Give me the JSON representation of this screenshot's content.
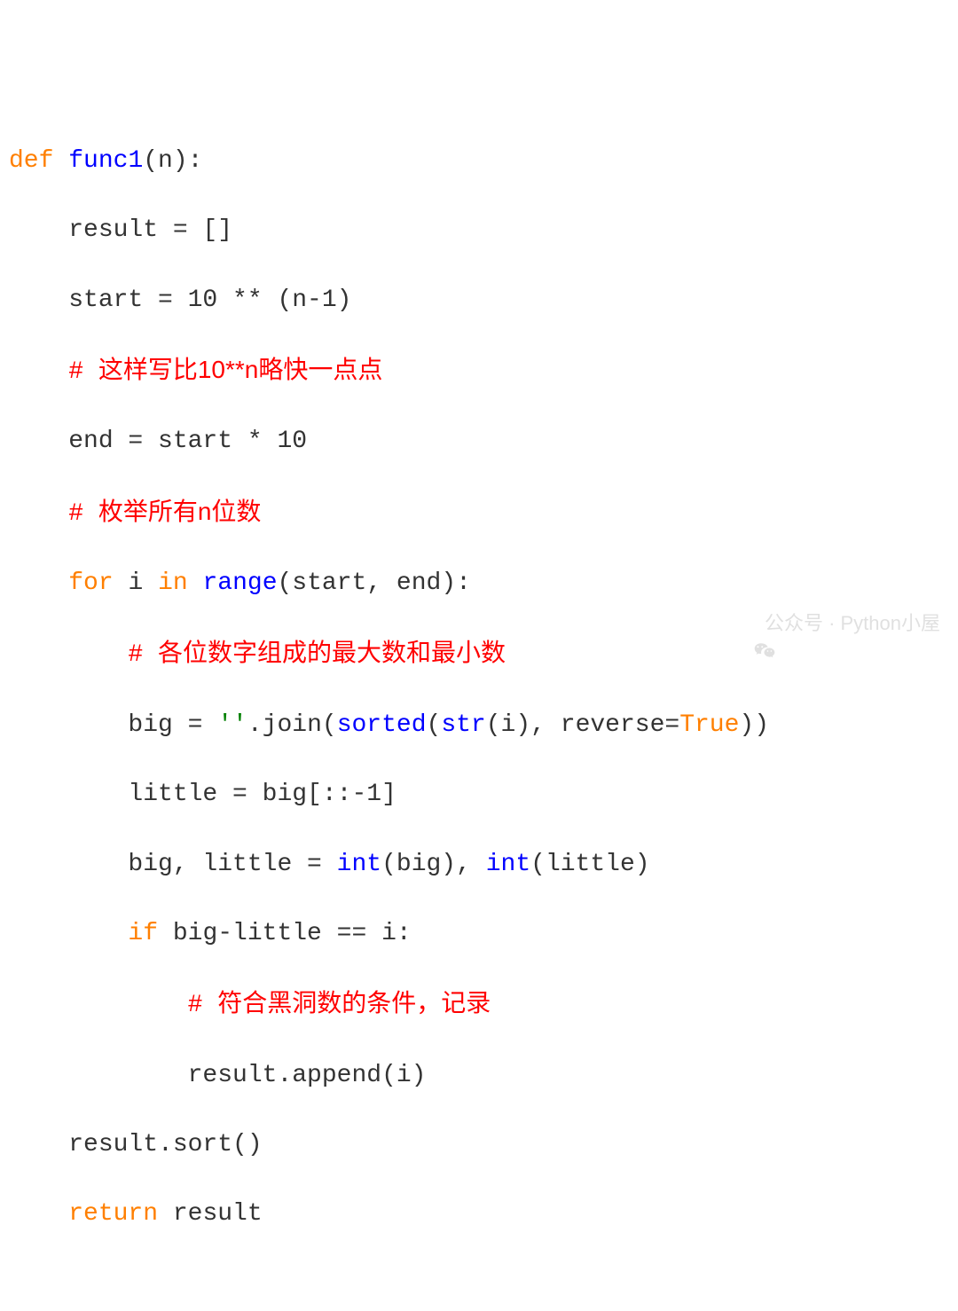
{
  "lines": {
    "l1_def": "def",
    "l1_func": "func1",
    "l1_rest": "(n):",
    "l2": "    result = []",
    "l3": "    start = 10 ** (n-1)",
    "l4_hash": "    # ",
    "l4_text": "这样写比10**n略快一点点",
    "l5": "    end = start * 10",
    "l6_hash": "    # ",
    "l6_text": "枚举所有n位数",
    "l7_pre": "    ",
    "l7_for": "for",
    "l7_mid1": " i ",
    "l7_in": "in",
    "l7_mid2": " ",
    "l7_range": "range",
    "l7_rest": "(start, end):",
    "l8_hash": "        # ",
    "l8_text": "各位数字组成的最大数和最小数",
    "l9_pre": "        big = ",
    "l9_str": "''",
    "l9_mid1": ".join(",
    "l9_sorted": "sorted",
    "l9_mid2": "(",
    "l9_strf": "str",
    "l9_mid3": "(i), reverse=",
    "l9_true": "True",
    "l9_rest": "))",
    "l10": "        little = big[::-1]",
    "l11_pre": "        big, little = ",
    "l11_int1": "int",
    "l11_mid": "(big), ",
    "l11_int2": "int",
    "l11_rest": "(little)",
    "l12_pre": "        ",
    "l12_if": "if",
    "l12_rest": " big-little == i:",
    "l13_hash": "            # ",
    "l13_text": "符合黑洞数的条件，记录",
    "l14": "            result.append(i)",
    "l15": "    result.sort()",
    "l16_pre": "    ",
    "l16_return": "return",
    "l16_rest": " result"
  },
  "watermark": {
    "text": "公众号 · Python小屋"
  }
}
